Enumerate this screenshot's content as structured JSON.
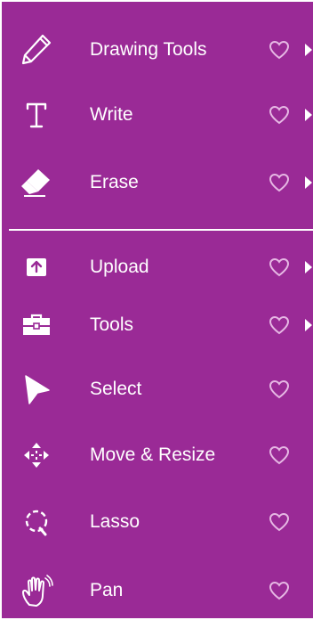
{
  "menu": {
    "items": [
      {
        "label": "Drawing Tools",
        "icon": "pencil-icon",
        "has_submenu": true
      },
      {
        "label": "Write",
        "icon": "text-cursor-icon",
        "has_submenu": true
      },
      {
        "label": "Erase",
        "icon": "eraser-icon",
        "has_submenu": true
      },
      {
        "label": "Upload",
        "icon": "upload-icon",
        "has_submenu": true
      },
      {
        "label": "Tools",
        "icon": "toolbox-icon",
        "has_submenu": true
      },
      {
        "label": "Select",
        "icon": "pointer-icon",
        "has_submenu": false
      },
      {
        "label": "Move & Resize",
        "icon": "move-arrows-icon",
        "has_submenu": false
      },
      {
        "label": "Lasso",
        "icon": "lasso-icon",
        "has_submenu": false
      },
      {
        "label": "Pan",
        "icon": "hand-icon",
        "has_submenu": false
      }
    ],
    "favorite_icon": "heart-outline-icon",
    "submenu_icon": "chevron-right-icon"
  },
  "colors": {
    "background": "#9a2a96",
    "foreground": "#ffffff",
    "heart": "#e6b8e4"
  }
}
